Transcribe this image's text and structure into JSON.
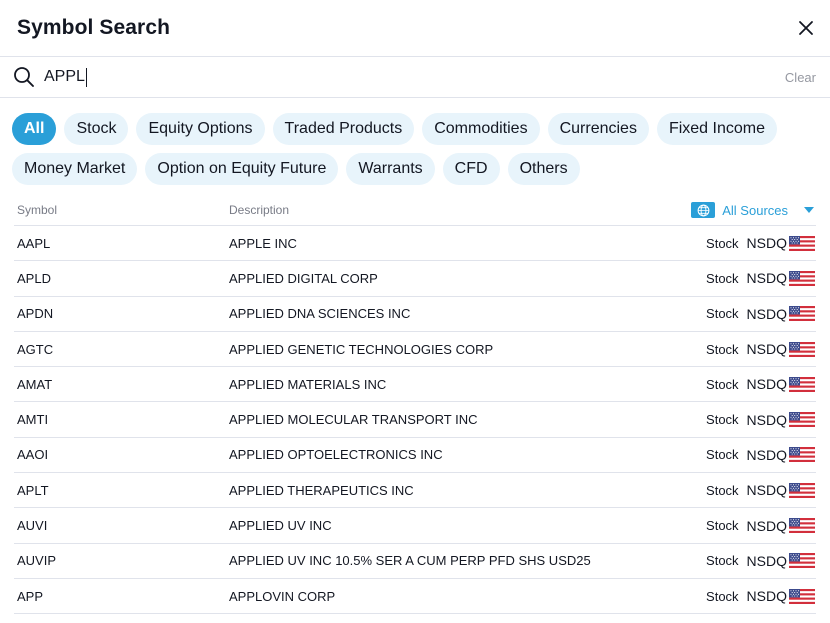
{
  "dialog": {
    "title": "Symbol Search",
    "close_icon": "close-icon"
  },
  "search": {
    "value": "APPL",
    "clear_label": "Clear",
    "icon": "search-icon"
  },
  "filters": [
    {
      "label": "All",
      "active": true
    },
    {
      "label": "Stock",
      "active": false
    },
    {
      "label": "Equity Options",
      "active": false
    },
    {
      "label": "Traded Products",
      "active": false
    },
    {
      "label": "Commodities",
      "active": false
    },
    {
      "label": "Currencies",
      "active": false
    },
    {
      "label": "Fixed Income",
      "active": false
    },
    {
      "label": "Money Market",
      "active": false
    },
    {
      "label": "Option on Equity Future",
      "active": false
    },
    {
      "label": "Warrants",
      "active": false
    },
    {
      "label": "CFD",
      "active": false
    },
    {
      "label": "Others",
      "active": false
    }
  ],
  "table": {
    "headers": {
      "symbol": "Symbol",
      "description": "Description"
    },
    "sources_label": "All Sources",
    "rows": [
      {
        "symbol": "AAPL",
        "description": "APPLE INC",
        "type": "Stock",
        "exchange": "NSDQ",
        "flag": "us-flag-icon"
      },
      {
        "symbol": "APLD",
        "description": "APPLIED DIGITAL CORP",
        "type": "Stock",
        "exchange": "NSDQ",
        "flag": "us-flag-icon"
      },
      {
        "symbol": "APDN",
        "description": "APPLIED DNA SCIENCES INC",
        "type": "Stock",
        "exchange": "NSDQ",
        "flag": "us-flag-icon"
      },
      {
        "symbol": "AGTC",
        "description": "APPLIED GENETIC TECHNOLOGIES CORP",
        "type": "Stock",
        "exchange": "NSDQ",
        "flag": "us-flag-icon"
      },
      {
        "symbol": "AMAT",
        "description": "APPLIED MATERIALS INC",
        "type": "Stock",
        "exchange": "NSDQ",
        "flag": "us-flag-icon"
      },
      {
        "symbol": "AMTI",
        "description": "APPLIED MOLECULAR TRANSPORT INC",
        "type": "Stock",
        "exchange": "NSDQ",
        "flag": "us-flag-icon"
      },
      {
        "symbol": "AAOI",
        "description": "APPLIED OPTOELECTRONICS INC",
        "type": "Stock",
        "exchange": "NSDQ",
        "flag": "us-flag-icon"
      },
      {
        "symbol": "APLT",
        "description": "APPLIED THERAPEUTICS INC",
        "type": "Stock",
        "exchange": "NSDQ",
        "flag": "us-flag-icon"
      },
      {
        "symbol": "AUVI",
        "description": "APPLIED UV INC",
        "type": "Stock",
        "exchange": "NSDQ",
        "flag": "us-flag-icon"
      },
      {
        "symbol": "AUVIP",
        "description": "APPLIED UV INC 10.5% SER A CUM PERP PFD SHS USD25",
        "type": "Stock",
        "exchange": "NSDQ",
        "flag": "us-flag-icon"
      },
      {
        "symbol": "APP",
        "description": "APPLOVIN CORP",
        "type": "Stock",
        "exchange": "NSDQ",
        "flag": "us-flag-icon"
      }
    ]
  },
  "colors": {
    "accent": "#2a9fd8",
    "chip_bg": "#e8f4fb",
    "divider": "#e0e3eb",
    "muted_text": "#787b86"
  }
}
